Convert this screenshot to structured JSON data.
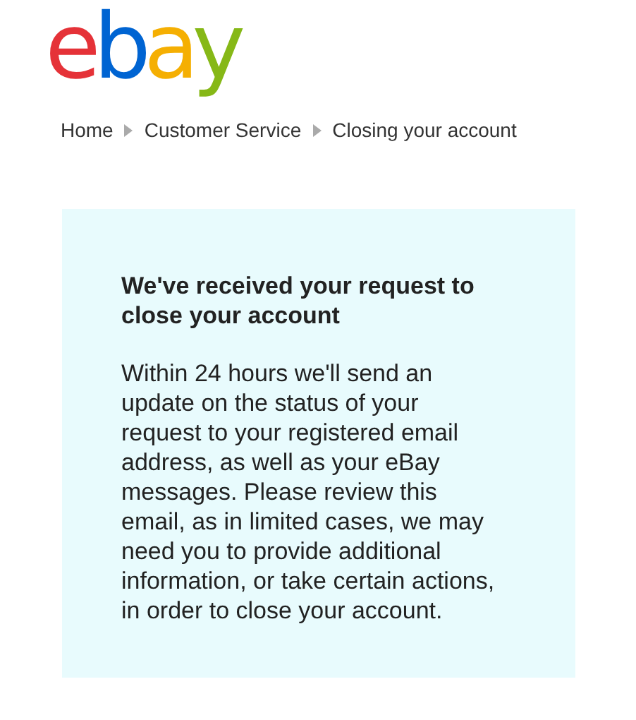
{
  "logo": {
    "letters": [
      {
        "char": "e",
        "color": "#e53238"
      },
      {
        "char": "b",
        "color": "#0064d2"
      },
      {
        "char": "a",
        "color": "#f5af02"
      },
      {
        "char": "y",
        "color": "#86b817"
      }
    ]
  },
  "breadcrumb": [
    "Home",
    "Customer Service",
    "Closing your account"
  ],
  "card": {
    "title": "We've received your request to close your account",
    "body": "Within 24 hours we'll send an update on the status of your request to your registered email address, as well as your eBay messages. Please review this email, as in limited cases, we may need you to provide additional information, or take certain actions, in order to close your account."
  }
}
